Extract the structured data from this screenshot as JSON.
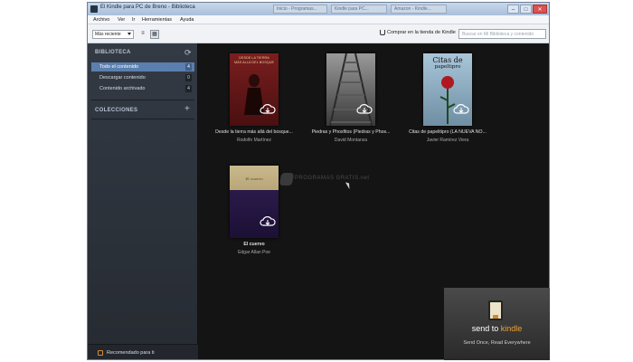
{
  "window": {
    "title": "El Kindle para PC de Breno - Biblioteca",
    "controls": {
      "minimize": "–",
      "maximize": "□",
      "close": "✕"
    }
  },
  "background_tabs": [
    "Inicio - Programas...",
    "Kindle para PC...",
    "Amazon - Kindle..."
  ],
  "menubar": {
    "items": [
      "Archivo",
      "Ver",
      "Ir",
      "Herramientas",
      "Ayuda"
    ]
  },
  "toolbar": {
    "sort_selected": "Más reciente",
    "view_list_glyph": "≡",
    "view_grid_glyph": "▦",
    "store_link": "Comprar en la tienda de Kindle",
    "search_placeholder": "Buscar en Mi Biblioteca y contenido"
  },
  "sidebar": {
    "library_header": "BIBLIOTECA",
    "refresh_glyph": "⟳",
    "items": [
      {
        "label": "Todo el contenido",
        "count": "4"
      },
      {
        "label": "Descargar contenido",
        "count": "0"
      },
      {
        "label": "Contenido archivado",
        "count": "4"
      }
    ],
    "collections_header": "COLECCIONES",
    "add_glyph": "+",
    "recommended": "Recomendado para ti"
  },
  "books": [
    {
      "title": "Desde la tierra más allá del bosque...",
      "author": "Rodolfo Martínez",
      "cover_lines": [
        "DESDE LA TIERRA",
        "MÁS ALLÁ DEL BOSQUE"
      ],
      "cover_color": "#6e1a1a"
    },
    {
      "title": "Piedras y Phosfitos (Piedras y Phos...",
      "author": "David Montanza",
      "cover_lines": [],
      "cover_color": "#4c4c4c"
    },
    {
      "title": "Citas de papelitipro (LA NUEVA NO...",
      "author": "Javier Ramírez Viera",
      "cover_lines": [
        "Citas de",
        "papeltipro"
      ],
      "cover_color": "#8ba8bd"
    },
    {
      "title": "El cuervo",
      "author": "Edgar Allan Poe",
      "cover_lines": [
        "El cuervo"
      ],
      "cover_color": "#2a1a4a"
    }
  ],
  "watermark": "PROGRAMAS GRATIS.net",
  "send_to_kindle": {
    "logo_a": "send to ",
    "logo_b": "kindle",
    "tagline": "Send Once, Read Everywhere"
  }
}
